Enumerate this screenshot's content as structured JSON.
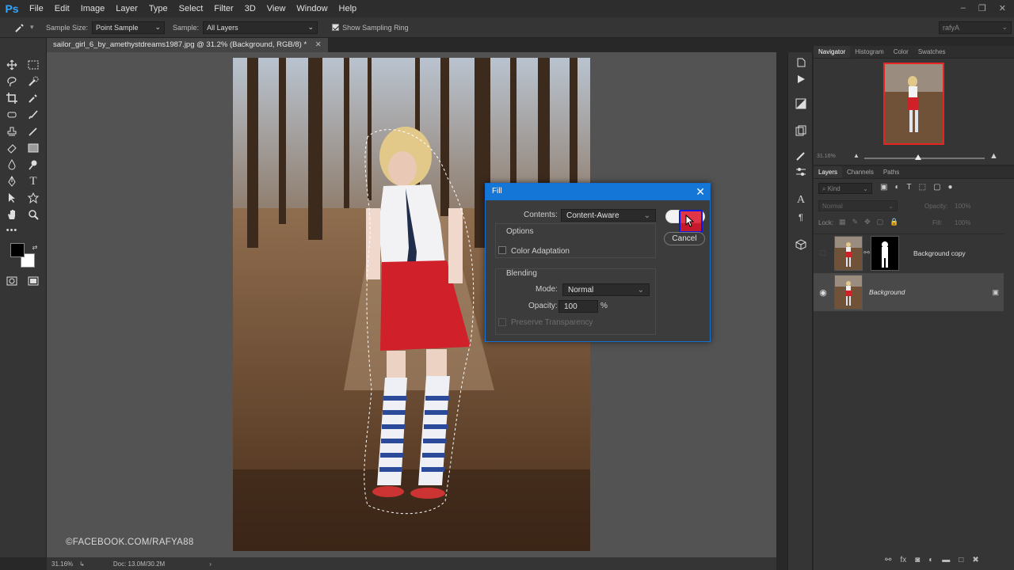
{
  "app": {
    "logo": "Ps"
  },
  "menu": [
    "File",
    "Edit",
    "Image",
    "Layer",
    "Type",
    "Select",
    "Filter",
    "3D",
    "View",
    "Window",
    "Help"
  ],
  "options_bar": {
    "sample_size_label": "Sample Size:",
    "sample_size_value": "Point Sample",
    "sample_label": "Sample:",
    "sample_value": "All Layers",
    "show_ring_label": "Show Sampling Ring",
    "workspace": "rafyA"
  },
  "document": {
    "tab_title": "sailor_girl_6_by_amethystdreams1987.jpg @ 31.2% (Background, RGB/8) *",
    "watermark": "©FACEBOOK.COM/RAFYA88"
  },
  "status": {
    "zoom": "31.16%",
    "doc": "Doc: 13.0M/30.2M"
  },
  "navigator": {
    "tabs": [
      "Navigator",
      "Histogram",
      "Color",
      "Swatches"
    ],
    "zoom": "31.16%"
  },
  "layers_panel": {
    "tabs": [
      "Layers",
      "Channels",
      "Paths"
    ],
    "kind_label": "Kind",
    "blend_mode": "Normal",
    "opacity_label": "Opacity:",
    "opacity_value": "100%",
    "lock_label": "Lock:",
    "fill_label": "Fill:",
    "fill_value": "100%",
    "layers": [
      {
        "name": "Background copy",
        "visible": false,
        "locked": false
      },
      {
        "name": "Background",
        "visible": true,
        "locked": true
      }
    ]
  },
  "fill_dialog": {
    "title": "Fill",
    "contents_label": "Contents:",
    "contents_value": "Content-Aware",
    "ok_label": "OK",
    "cancel_label": "Cancel",
    "options_heading": "Options",
    "color_adaptation_label": "Color Adaptation",
    "blending_heading": "Blending",
    "mode_label": "Mode:",
    "mode_value": "Normal",
    "opacity_label": "Opacity:",
    "opacity_value": "100",
    "opacity_unit": "%",
    "preserve_label": "Preserve Transparency"
  },
  "colors": {
    "accent": "#1477d8",
    "foreground": "#000000",
    "background": "#ffffff"
  }
}
